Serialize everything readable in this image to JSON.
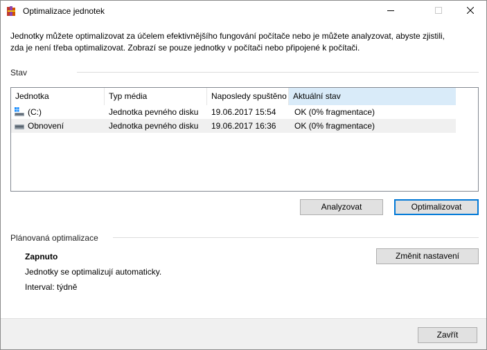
{
  "window": {
    "title": "Optimalizace jednotek",
    "icon": "defrag-app-icon",
    "controls": [
      "minimize-icon",
      "maximize-icon",
      "close-icon"
    ]
  },
  "intro": {
    "line1": "Jednotky můžete optimalizovat za účelem efektivnějšího fungování počítače nebo je můžete analyzovat, abyste zjistili,",
    "line2": "zda je není třeba optimalizovat. Zobrazí se pouze jednotky v počítači nebo připojené k počítači."
  },
  "status": {
    "heading": "Stav",
    "columns": [
      "Jednotka",
      "Typ média",
      "Naposledy spuštěno",
      "Aktuální stav"
    ],
    "rows": [
      {
        "icon": "windows-drive-icon",
        "drive": "(C:)",
        "media": "Jednotka pevného disku",
        "last_run": "19.06.2017 15:54",
        "state": "OK (0% fragmentace)"
      },
      {
        "icon": "drive-icon",
        "drive": "Obnovení",
        "media": "Jednotka pevného disku",
        "last_run": "19.06.2017 16:36",
        "state": "OK (0% fragmentace)"
      }
    ],
    "analyze_label": "Analyzovat",
    "optimize_label": "Optimalizovat"
  },
  "scheduled": {
    "heading": "Plánovaná optimalizace",
    "state": "Zapnuto",
    "description": "Jednotky se optimalizují automaticky.",
    "interval": "Interval: týdně",
    "change_label": "Změnit nastavení"
  },
  "footer": {
    "close_label": "Zavřít"
  },
  "colors": {
    "accent": "#0078d7",
    "sorted_header": "#d9ebf9",
    "button_face": "#e1e1e1",
    "footer_bg": "#f0f0f0"
  }
}
